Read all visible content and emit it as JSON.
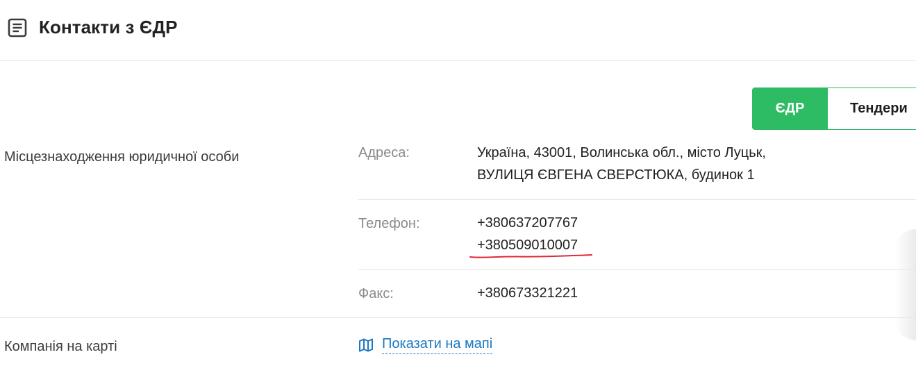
{
  "header": {
    "title": "Контакти з ЄДР",
    "icon": "document-list-icon"
  },
  "toggle": {
    "active_label": "ЄДР",
    "inactive_label": "Тендери",
    "accent_color": "#2dbb64"
  },
  "location_section": {
    "label": "Місцезнаходження юридичної особи",
    "address": {
      "label": "Адреса:",
      "line1": "Україна, 43001, Волинська обл., місто Луцьк,",
      "line2": "ВУЛИЦЯ ЄВГЕНА СВЕРСТЮКА, будинок 1"
    },
    "phone": {
      "label": "Телефон:",
      "values": [
        "+380637207767",
        "+380509010007"
      ]
    },
    "fax": {
      "label": "Факс:",
      "value": "+380673321221"
    }
  },
  "map_section": {
    "label": "Компанія на карті",
    "link_text": "Показати на мапі",
    "icon": "map-icon",
    "link_color": "#1a78c2"
  }
}
